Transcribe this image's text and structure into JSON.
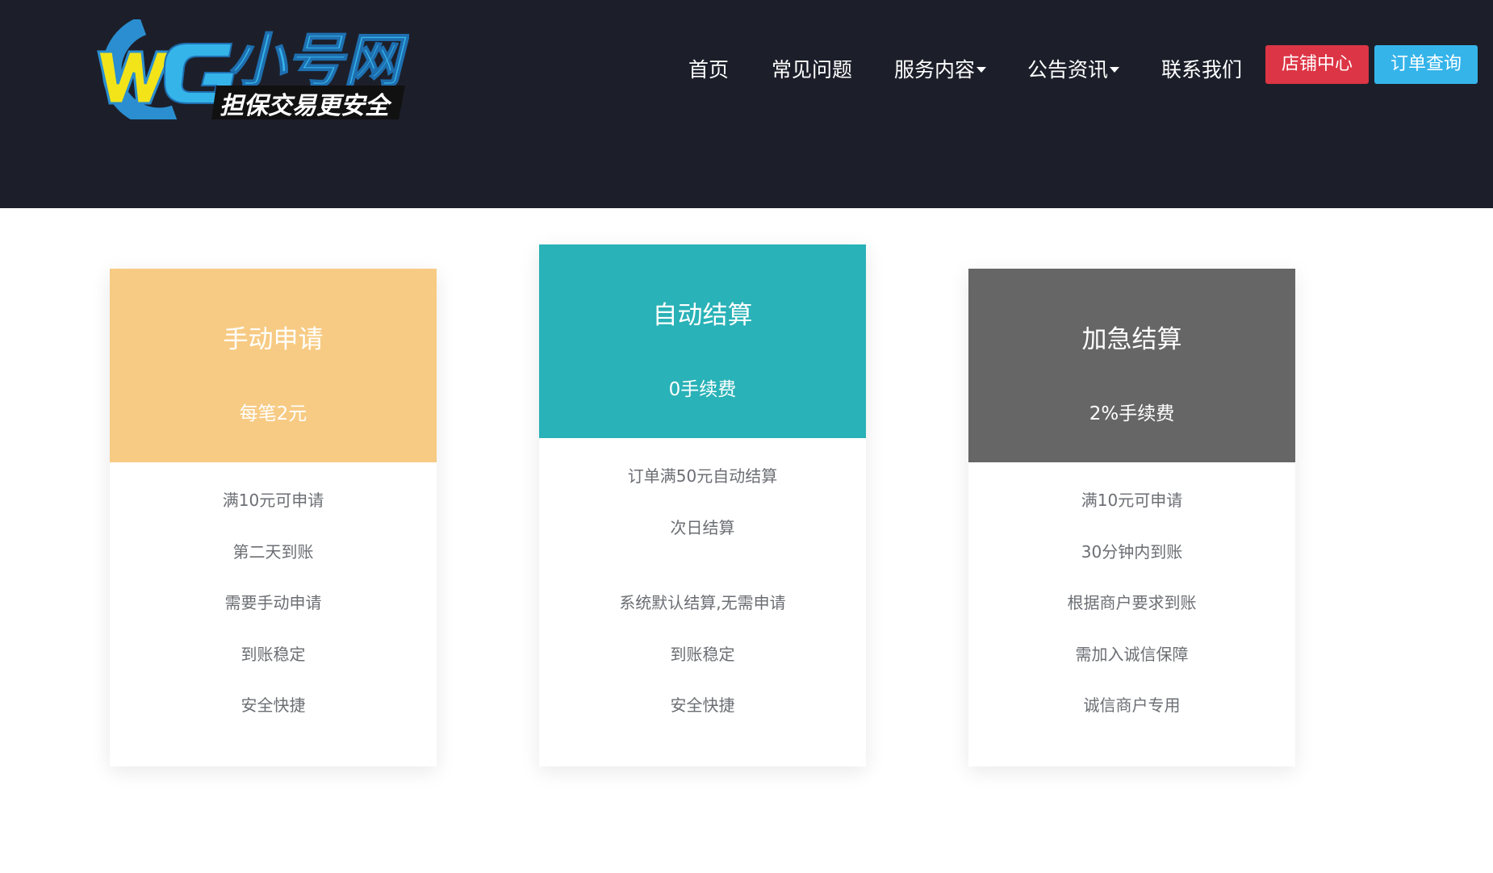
{
  "header": {
    "logo": {
      "main_text": "小号网",
      "slogan": "担保交易更安全"
    },
    "nav": [
      {
        "label": "首页",
        "has_dropdown": false
      },
      {
        "label": "常见问题",
        "has_dropdown": false
      },
      {
        "label": "服务内容",
        "has_dropdown": true
      },
      {
        "label": "公告资讯",
        "has_dropdown": true
      },
      {
        "label": "联系我们",
        "has_dropdown": false
      }
    ],
    "buttons": {
      "shop_center": "店铺中心",
      "order_query": "订单查询"
    }
  },
  "cards": [
    {
      "title": "手动申请",
      "price": "每笔2元",
      "color": "#f7cb84",
      "features": [
        "满10元可申请",
        "第二天到账",
        "需要手动申请",
        "到账稳定",
        "安全快捷"
      ]
    },
    {
      "title": "自动结算",
      "price": "0手续费",
      "color": "#29b2b7",
      "features": [
        "订单满50元自动结算",
        "次日结算",
        "系统默认结算,无需申请",
        "到账稳定",
        "安全快捷"
      ]
    },
    {
      "title": "加急结算",
      "price": "2%手续费",
      "color": "#666666",
      "features": [
        "满10元可申请",
        "30分钟内到账",
        "根据商户要求到账",
        "需加入诚信保障",
        "诚信商户专用"
      ]
    }
  ],
  "colors": {
    "header_bg": "#1c1f2a",
    "shop_button": "#dc3545",
    "order_button": "#35b4ea",
    "feature_text": "#6b6e73"
  }
}
